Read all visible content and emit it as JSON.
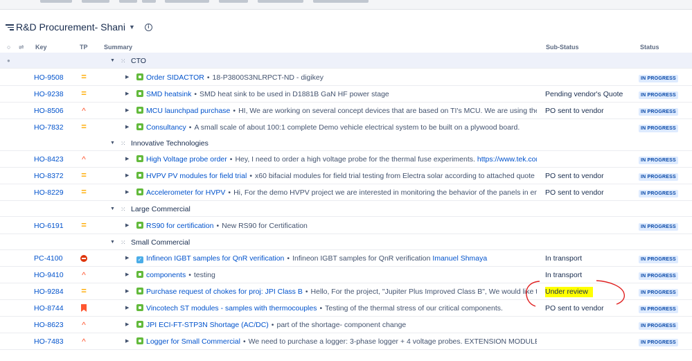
{
  "board": {
    "title": "R&D Procurement- Shani",
    "icon": "board-filter-icon",
    "info_icon_glyph": "i"
  },
  "columns": {
    "key": "Key",
    "tp": "TP",
    "summary": "Summary",
    "substatus": "Sub-Status",
    "status": "Status"
  },
  "colors": {
    "accent": "#0052cc",
    "status_bg": "#deebff",
    "status_fg": "#0747a6",
    "story": "#63ba3c",
    "task": "#4bade8",
    "medium": "#ffab00",
    "high": "#ff5630",
    "highlight": "#ffff00",
    "annotation": "#e02020"
  },
  "groups": [
    {
      "name": "CTO"
    },
    {
      "name": "Innovative Technologies"
    },
    {
      "name": "Large Commercial"
    },
    {
      "name": "Small Commercial"
    }
  ],
  "issues": [
    {
      "key": "HO-9508",
      "priority": "medium",
      "type": "story",
      "title": "Order SIDACTOR",
      "desc": "18-P3800S3NLRPCT-ND - digikey",
      "substatus": "",
      "status": "IN PROGRESS"
    },
    {
      "key": "HO-9238",
      "priority": "medium",
      "type": "story",
      "title": "SMD heatsink",
      "desc": "SMD heat sink to be used in D1881B GaN HF power stage",
      "substatus": "Pending vendor's Quote",
      "status": "IN PROGRESS"
    },
    {
      "key": "HO-8506",
      "priority": "high",
      "type": "story",
      "title": "MCU launchpad purchase",
      "desc": "HI, We are working on several concept devices that are based on TI's MCU. We are using the launch",
      "substatus": "PO sent to vendor",
      "status": "IN PROGRESS"
    },
    {
      "key": "HO-7832",
      "priority": "medium",
      "type": "story",
      "title": "Consultancy",
      "desc": "A small scale of about 100:1 complete Demo vehicle electrical system to be built on a plywood board.",
      "substatus": "",
      "status": "IN PROGRESS"
    },
    {
      "key": "HO-8423",
      "priority": "high",
      "type": "story",
      "title": "High Voltage probe order",
      "desc": "Hey, I need to order a high voltage probe for the thermal fuse experiments.",
      "desc_link": "https://www.tek.com/e",
      "substatus": "",
      "status": "IN PROGRESS"
    },
    {
      "key": "HO-8372",
      "priority": "medium",
      "type": "story",
      "title": "HVPV PV modules for field trial",
      "desc": "x60 bifacial modules for field trial testing from Electra solar according to attached quote",
      "substatus": "PO sent to vendor",
      "status": "IN PROGRESS"
    },
    {
      "key": "HO-8229",
      "priority": "medium",
      "type": "story",
      "title": "Accelerometer for HVPV",
      "desc": "Hi, For the demo HVPV project we are interested in monitoring the behavior of the panels in enviro",
      "substatus": "PO sent to vendor",
      "status": "IN PROGRESS"
    },
    {
      "key": "HO-6191",
      "priority": "medium",
      "type": "story",
      "title": "RS90 for certification",
      "desc": "New RS90 for Certification",
      "substatus": "",
      "status": "IN PROGRESS"
    },
    {
      "key": "PC-4100",
      "priority": "blocker",
      "type": "task",
      "title": "Infineon IGBT samples for QnR verification",
      "desc": "Infineon IGBT samples for QnR verification",
      "desc_user": "Imanuel Shmaya",
      "substatus": "In transport",
      "status": "IN PROGRESS"
    },
    {
      "key": "HO-9410",
      "priority": "high",
      "type": "story",
      "title": "components",
      "desc": "testing",
      "substatus": "In transport",
      "status": "IN PROGRESS"
    },
    {
      "key": "HO-9284",
      "priority": "medium",
      "type": "story",
      "title": "Purchase request of chokes for proj: JPI Class B",
      "desc": "Hello, For the project, \"Jupiter Plus Improved Class B\", We would like to purch",
      "substatus": "Under review",
      "status": "IN PROGRESS"
    },
    {
      "key": "HO-8744",
      "priority": "flag",
      "type": "story",
      "title": "Vincotech ST modules - samples with thermocouples",
      "desc": "Testing of the thermal stress of our critical components.",
      "substatus": "PO sent to vendor",
      "status": "IN PROGRESS"
    },
    {
      "key": "HO-8623",
      "priority": "high",
      "type": "story",
      "title": "JPI ECI-FT-STP3N Shortage (AC/DC)",
      "desc": "part of the shortage- component change",
      "substatus": "",
      "status": "IN PROGRESS"
    },
    {
      "key": "HO-7483",
      "priority": "high",
      "type": "story",
      "title": "Logger for Small Commercial",
      "desc": "We need to purchase a logger:        3-phase logger + 4 voltage probes. EXTENSION MODULE",
      "substatus": "",
      "status": "IN PROGRESS"
    }
  ],
  "icons": {
    "expand": "chevron-right-icon",
    "collapse": "chevron-down-icon",
    "group_glyph": "drag-handle-icon",
    "medium": "priority-medium-icon",
    "high": "priority-high-icon",
    "blocker": "priority-blocker-icon",
    "flag": "flagged-icon"
  }
}
